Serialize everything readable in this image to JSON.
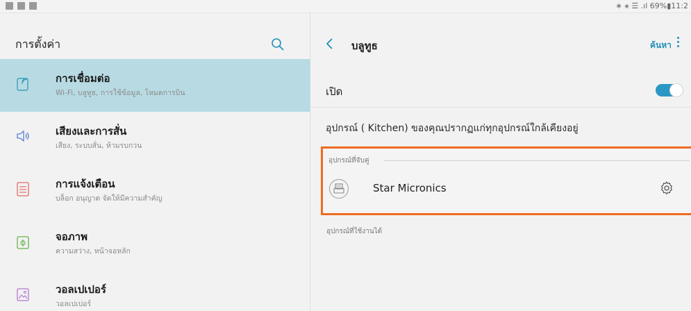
{
  "status": {
    "text": "∗ ⚹ ☰ .ıl 69%▮11:2"
  },
  "left": {
    "title": "การตั้งค่า",
    "items": [
      {
        "title": "การเชื่อมต่อ",
        "subtitle": "Wi-Fi, บลูทูธ, การใช้ข้อมูล, โหมดการบิน",
        "icon": "connections-icon"
      },
      {
        "title": "เสียงและการสั่น",
        "subtitle": "เสียง, ระบบสั่น, ห้ามรบกวน",
        "icon": "sound-icon"
      },
      {
        "title": "การแจ้งเตือน",
        "subtitle": "บล็อก อนุญาต จัดให้มีความสำคัญ",
        "icon": "notifications-icon"
      },
      {
        "title": "จอภาพ",
        "subtitle": "ความสว่าง, หน้าจอหลัก",
        "icon": "display-icon"
      },
      {
        "title": "วอลเปเปอร์",
        "subtitle": "วอลเปเปอร์",
        "icon": "wallpaper-icon"
      }
    ]
  },
  "right": {
    "title": "บลูทูธ",
    "search_label": "ค้นหา",
    "on_label": "เปิด",
    "toggle_on": true,
    "visible_text": "อุปกรณ์ (      Kitchen) ของคุณปรากฏแก่ทุกอุปกรณ์ใกล้เคียงอยู่",
    "paired_header": "อุปกรณ์ที่จับคู่",
    "paired_device": "Star Micronics",
    "available_header": "อุปกรณ์ที่ใช้งานได้"
  },
  "colors": {
    "accent": "#2b97c3",
    "selected_bg": "#b8dbe3",
    "highlight_border": "#ef6b1f"
  }
}
